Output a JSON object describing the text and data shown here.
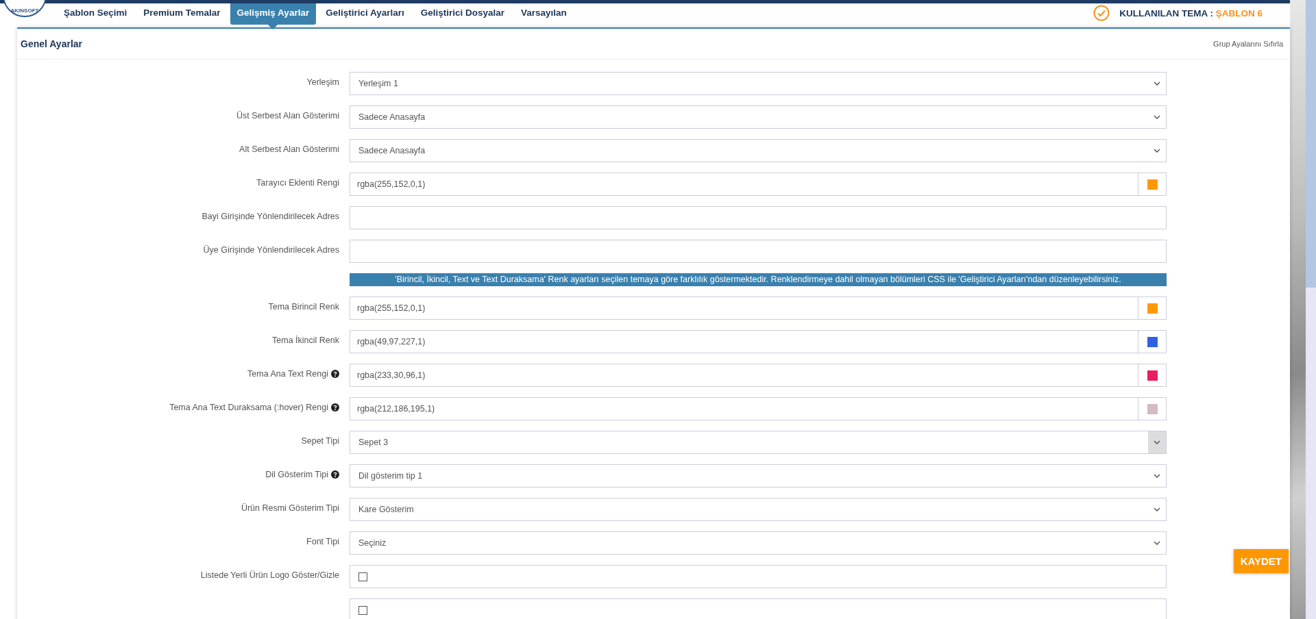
{
  "logo_text": "AKINSOFT",
  "tabs": [
    {
      "label": "Şablon Seçimi",
      "selected": false
    },
    {
      "label": "Premium Temalar",
      "selected": false
    },
    {
      "label": "Gelişmiş Ayarlar",
      "selected": true
    },
    {
      "label": "Geliştirici Ayarları",
      "selected": false
    },
    {
      "label": "Geliştirici Dosyalar",
      "selected": false
    },
    {
      "label": "Varsayılan",
      "selected": false
    }
  ],
  "theme_info": {
    "label": "KULLANILAN TEMA :",
    "value": "ŞABLON 6"
  },
  "panel": {
    "title": "Genel Ayarlar",
    "reset_link": "Grup Ayalarını Sıfırla"
  },
  "rows": [
    {
      "kind": "select",
      "label": "Yerleşim",
      "value": "Yerleşim 1",
      "help": false,
      "hover": false
    },
    {
      "kind": "select",
      "label": "Üst Serbest Alan Gösterimi",
      "value": "Sadece Anasayfa",
      "help": false,
      "hover": false
    },
    {
      "kind": "select",
      "label": "Alt Serbest Alan Gösterimi",
      "value": "Sadece Anasayfa",
      "help": false,
      "hover": false
    },
    {
      "kind": "color",
      "label": "Tarayıcı Eklenti Rengi",
      "value": "rgba(255,152,0,1)",
      "color": "#ff9800",
      "help": false
    },
    {
      "kind": "text",
      "label": "Bayi Girişinde Yönlendirilecek Adres",
      "help": false
    },
    {
      "kind": "text",
      "label": "Üye Girişinde Yönlendirilecek Adres",
      "help": false
    },
    {
      "kind": "notice",
      "text": "'Birincil, İkincil, Text ve Text Duraksama' Renk ayarları seçilen temaya göre farklılık göstermektedir. Renklendirmeye dahil olmayan bölümleri CSS ile 'Geliştirici Ayarları'ndan düzenleyebilirsiniz."
    },
    {
      "kind": "color",
      "label": "Tema Birincil Renk",
      "value": "rgba(255,152,0,1)",
      "color": "#ff9800",
      "help": false
    },
    {
      "kind": "color",
      "label": "Tema İkincil Renk",
      "value": "rgba(49,97,227,1)",
      "color": "#3161e3",
      "help": false
    },
    {
      "kind": "color",
      "label": "Tema Ana Text Rengi",
      "value": "rgba(233,30,96,1)",
      "color": "#e91e60",
      "help": true
    },
    {
      "kind": "color",
      "label": "Tema Ana Text Duraksama (:hover) Rengi",
      "value": "rgba(212,186,195,1)",
      "color": "#d4bac3",
      "help": true
    },
    {
      "kind": "select",
      "label": "Sepet Tipi",
      "value": "Sepet 3",
      "help": false,
      "hover": true
    },
    {
      "kind": "select",
      "label": "Dil Gösterim Tipi",
      "value": "Dil gösterim tip 1",
      "help": true,
      "hover": false
    },
    {
      "kind": "select",
      "label": "Ürün Resmi Gösterim Tipi",
      "value": "Kare Gösterim",
      "help": false,
      "hover": false
    },
    {
      "kind": "select",
      "label": "Font Tipi",
      "value": "Seçiniz",
      "help": false,
      "hover": false
    },
    {
      "kind": "checkbox",
      "label": "Listede Yerli Ürün Logo Göster/Gizle",
      "checked": false,
      "help": false
    },
    {
      "kind": "checkbox",
      "checked": false
    }
  ],
  "save_button": "KAYDET"
}
